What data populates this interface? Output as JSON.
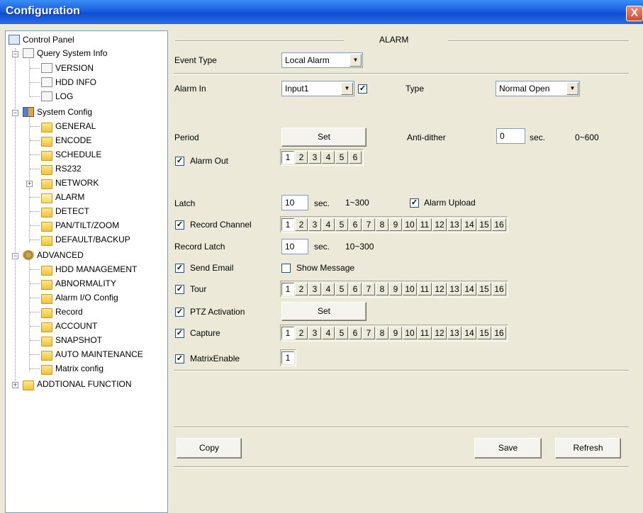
{
  "window": {
    "title": "Configuration",
    "close": "X"
  },
  "tree": {
    "root": "Control Panel",
    "query": "Query System Info",
    "version": "VERSION",
    "hdd_info": "HDD INFO",
    "log": "LOG",
    "system": "System Config",
    "general": "GENERAL",
    "encode": "ENCODE",
    "schedule": "SCHEDULE",
    "rs232": "RS232",
    "network": "NETWORK",
    "alarm": "ALARM",
    "detect": "DETECT",
    "ptz": "PAN/TILT/ZOOM",
    "default": "DEFAULT/BACKUP",
    "advanced": "ADVANCED",
    "hdd_mgmt": "HDD MANAGEMENT",
    "abnormality": "ABNORMALITY",
    "alarm_io": "Alarm I/O Config",
    "record": "Record",
    "account": "ACCOUNT",
    "snapshot": "SNAPSHOT",
    "auto_maint": "AUTO MAINTENANCE",
    "matrix": "Matrix config",
    "additional": "ADDTIONAL FUNCTION",
    "plus": "+",
    "minus": "−"
  },
  "panel": {
    "section": "ALARM",
    "event_type_label": "Event Type",
    "event_type_value": "Local Alarm",
    "alarm_in_label": "Alarm In",
    "alarm_in_value": "Input1",
    "type_label": "Type",
    "type_value": "Normal Open",
    "period_label": "Period",
    "set": "Set",
    "anti_dither_label": "Anti-dither",
    "anti_dither_value": "0",
    "sec": "sec.",
    "anti_range": "0~600",
    "alarm_out_label": "Alarm Out",
    "latch_label": "Latch",
    "latch_value": "10",
    "latch_range": "1~300",
    "alarm_upload_label": "Alarm Upload",
    "record_channel_label": "Record Channel",
    "record_latch_label": "Record Latch",
    "record_latch_value": "10",
    "record_latch_range": "10~300",
    "send_email_label": "Send Email",
    "show_message_label": "Show Message",
    "tour_label": "Tour",
    "ptz_label": "PTZ Activation",
    "capture_label": "Capture",
    "matrix_label": "MatrixEnable",
    "copy": "Copy",
    "save": "Save",
    "refresh": "Refresh",
    "check": "✓",
    "arrow": "▼"
  },
  "channels6": [
    "1",
    "2",
    "3",
    "4",
    "5",
    "6"
  ],
  "channels16": [
    "1",
    "2",
    "3",
    "4",
    "5",
    "6",
    "7",
    "8",
    "9",
    "10",
    "11",
    "12",
    "13",
    "14",
    "15",
    "16"
  ],
  "matrix_channels": [
    "1"
  ]
}
